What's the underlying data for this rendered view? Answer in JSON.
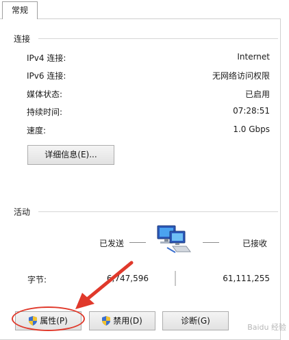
{
  "tabs": [
    {
      "label": "常规"
    }
  ],
  "connection": {
    "title": "连接",
    "rows": [
      {
        "label": "IPv4 连接:",
        "value": "Internet"
      },
      {
        "label": "IPv6 连接:",
        "value": "无网络访问权限"
      },
      {
        "label": "媒体状态:",
        "value": "已启用"
      },
      {
        "label": "持续时间:",
        "value": "07:28:51"
      },
      {
        "label": "速度:",
        "value": "1.0 Gbps"
      }
    ],
    "details_button": "详细信息(E)..."
  },
  "activity": {
    "title": "活动",
    "sent_label": "已发送",
    "received_label": "已接收",
    "bytes_label": "字节:",
    "bytes_sent": "6,747,596",
    "bytes_received": "61,111,255"
  },
  "buttons": {
    "properties": "属性(P)",
    "disable": "禁用(D)",
    "diagnose": "诊断(G)"
  },
  "watermark": "Baidu 经验",
  "colors": {
    "annotation": "#e0392b",
    "shield_blue": "#3a6fcf",
    "shield_yellow": "#f2c230"
  }
}
